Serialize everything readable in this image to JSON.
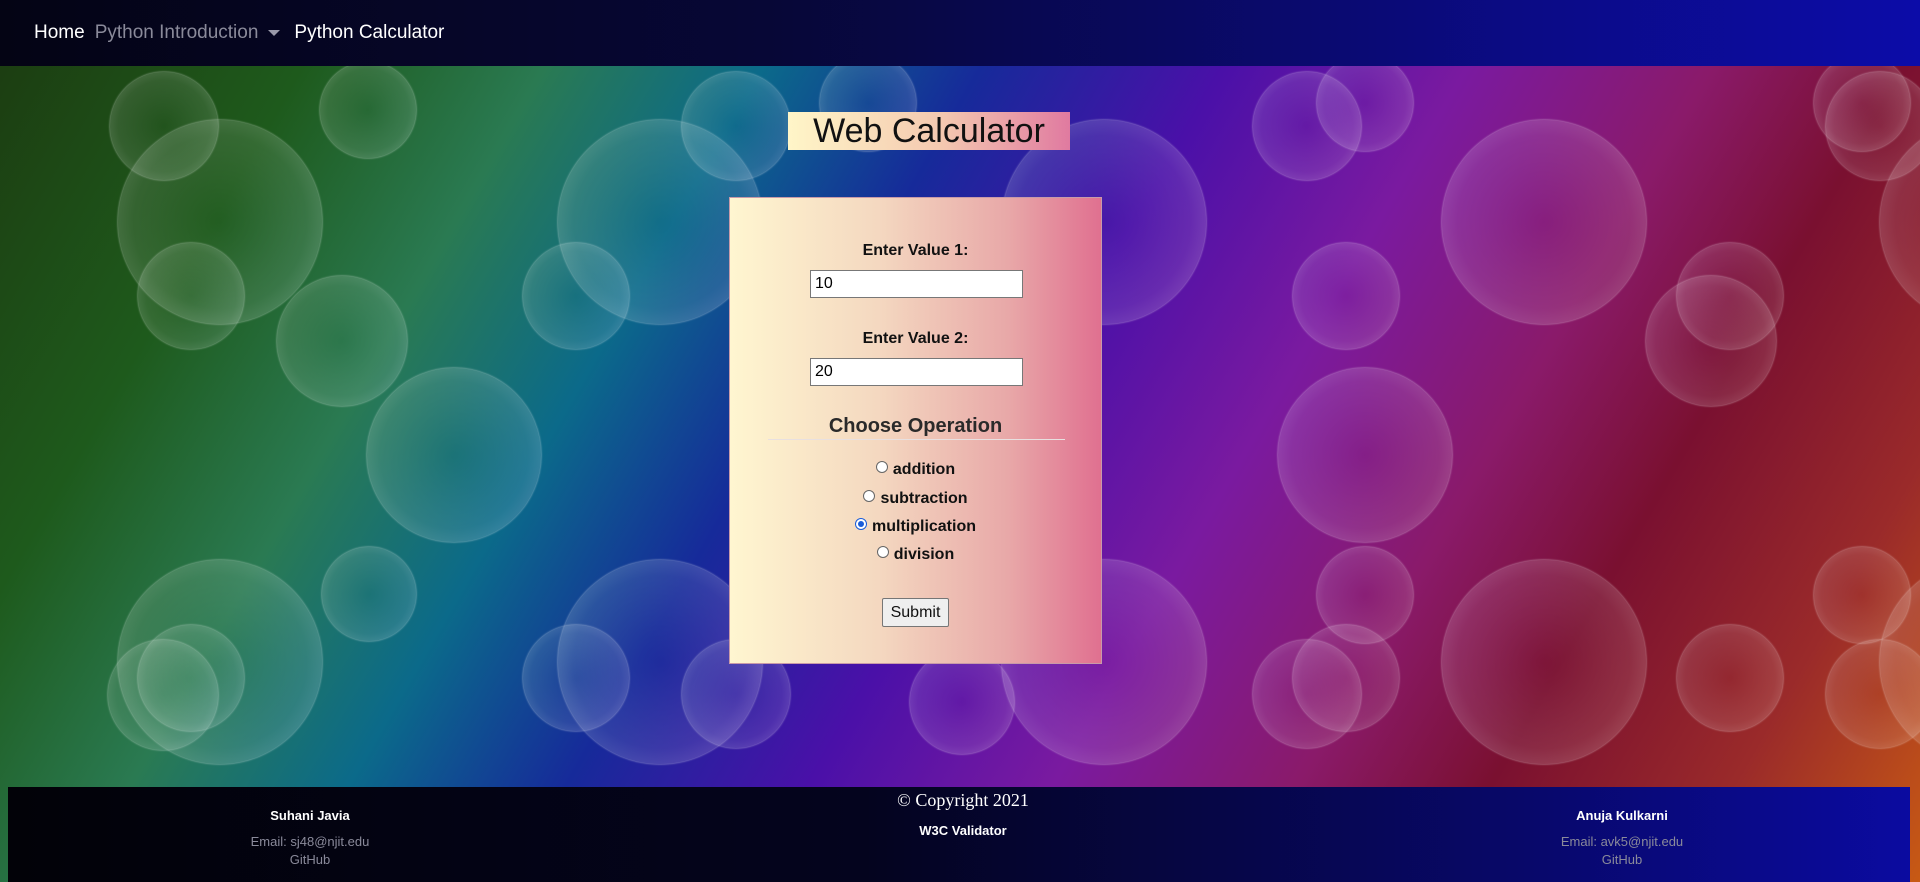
{
  "nav": {
    "home": "Home",
    "intro": "Python Introduction",
    "calculator": "Python Calculator"
  },
  "page": {
    "title": "Web Calculator"
  },
  "form": {
    "value1_label": "Enter Value 1:",
    "value1": "10",
    "value2_label": "Enter Value 2:",
    "value2": "20",
    "operation_heading": "Choose Operation",
    "operations": [
      "addition",
      "subtraction",
      "multiplication",
      "division"
    ],
    "selected_operation": "multiplication",
    "submit_label": "Submit"
  },
  "footer": {
    "left": {
      "name": "Suhani Javia",
      "email": "Email: sj48@njit.edu",
      "github": "GitHub"
    },
    "center": {
      "copyright": "© Copyright 2021",
      "validator": "W3C Validator"
    },
    "right": {
      "name": "Anuja Kulkarni",
      "email": "Email: avk5@njit.edu",
      "github": "GitHub"
    }
  },
  "colors": {
    "nav_bg": "#070736",
    "accent_radio": "#1a5cd8"
  }
}
